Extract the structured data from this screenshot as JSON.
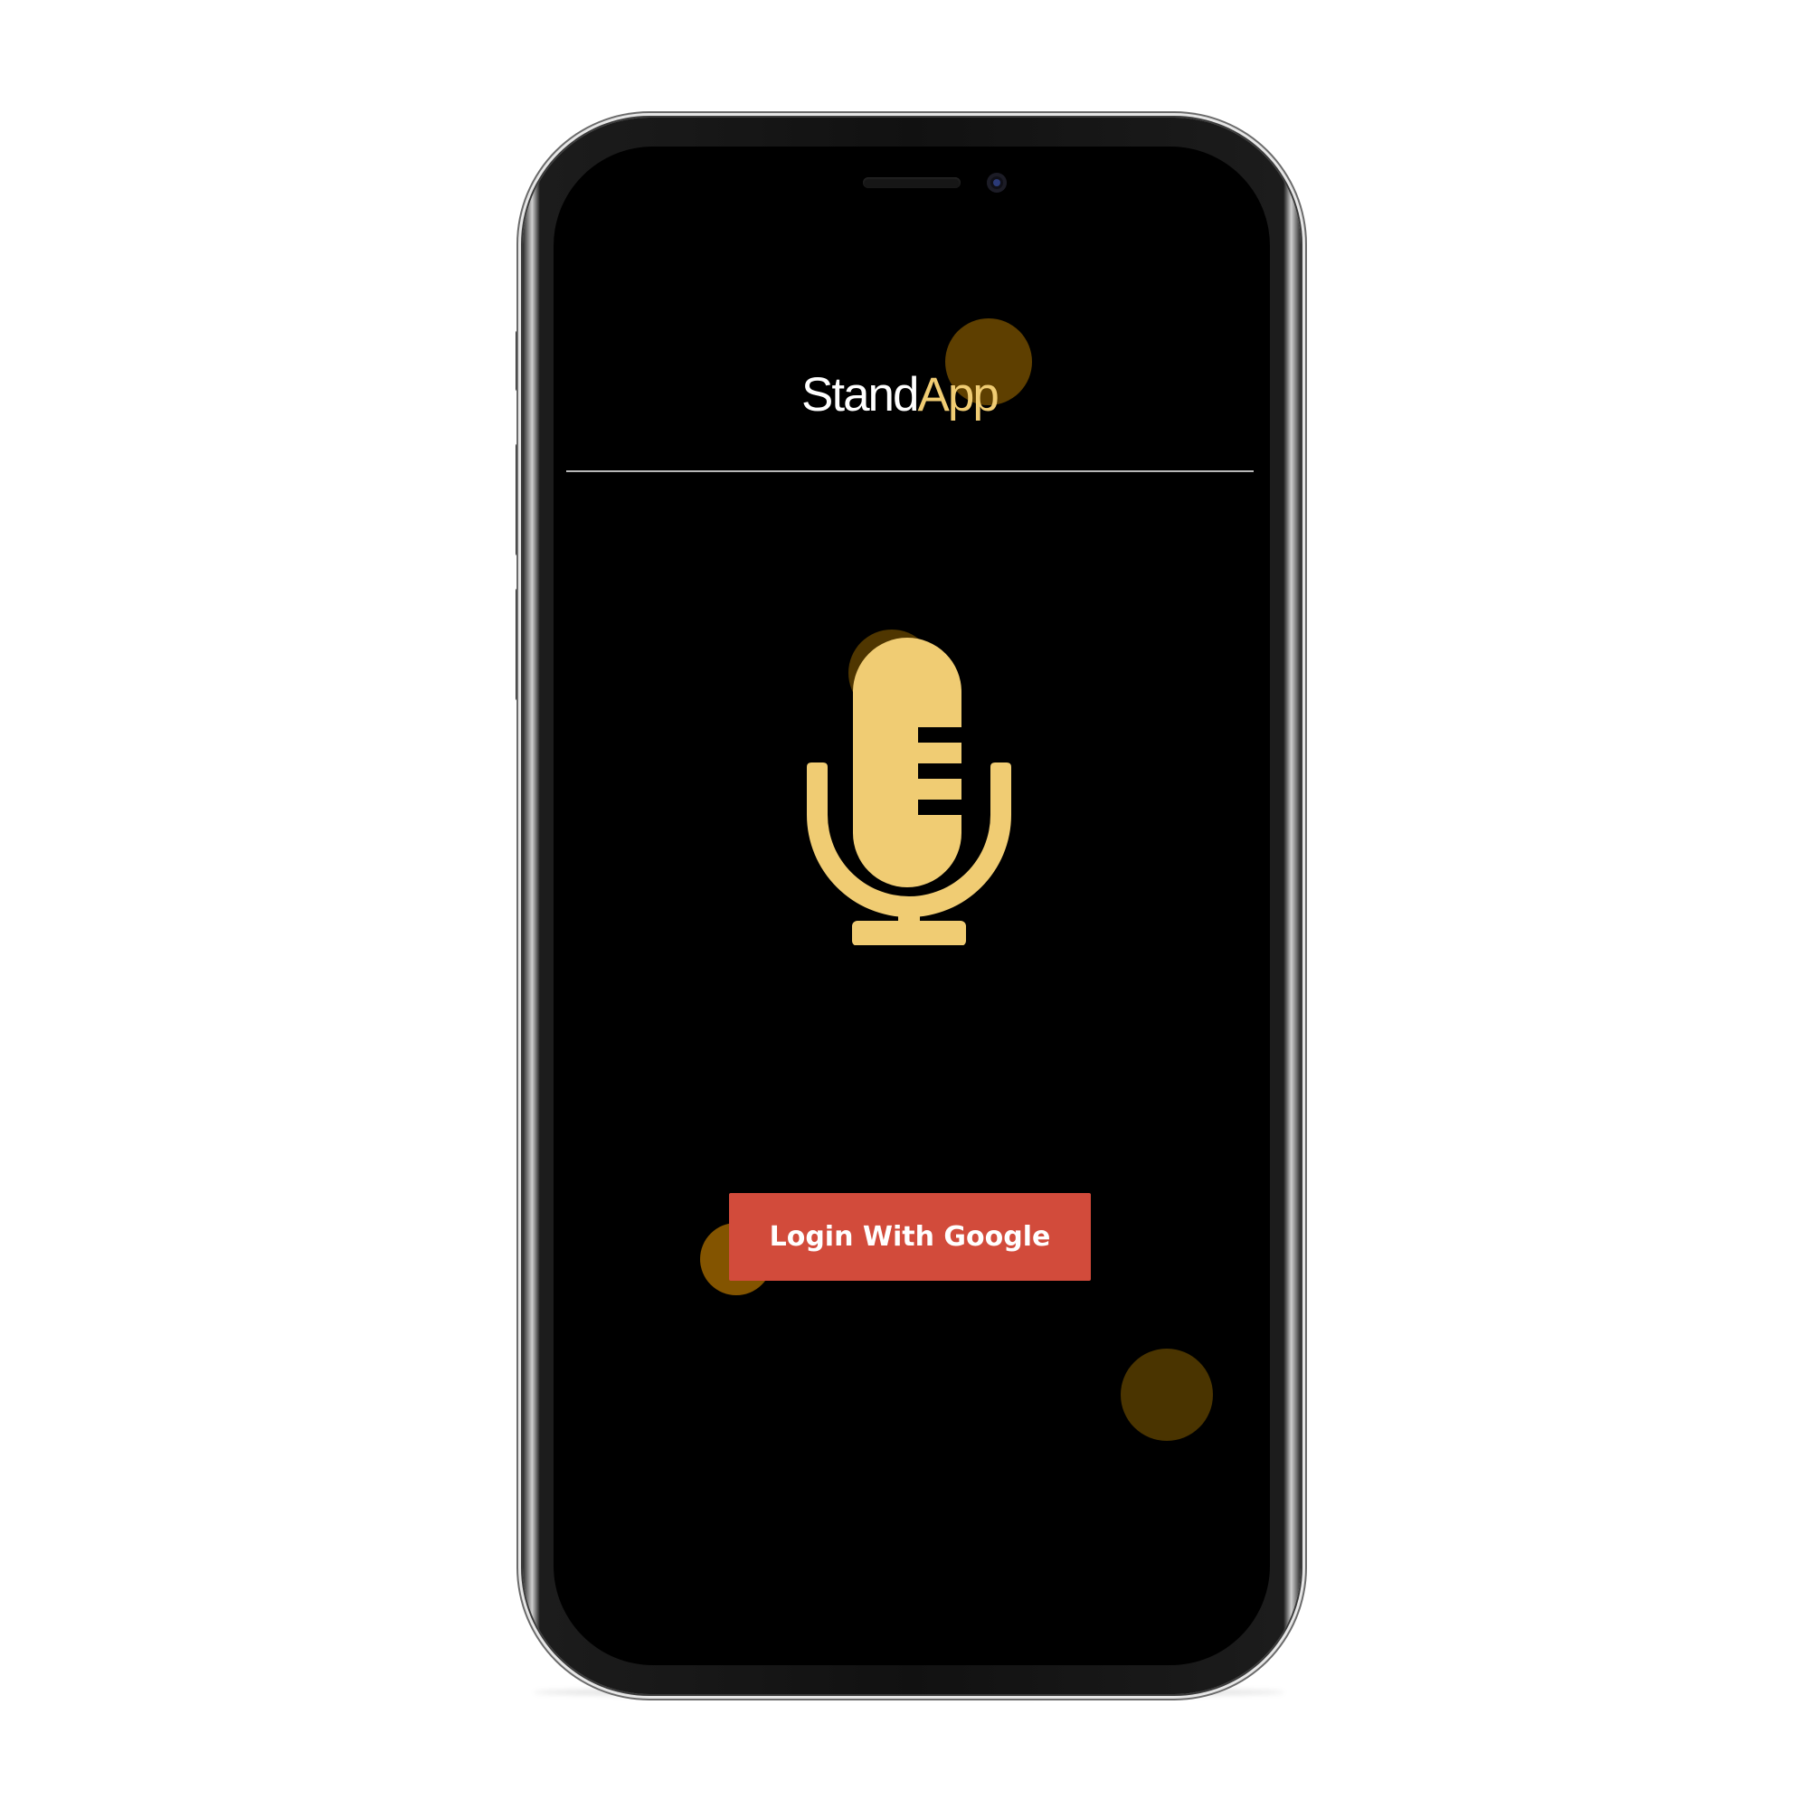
{
  "app": {
    "logo_primary": "Stand",
    "logo_accent": "App"
  },
  "icons": {
    "hero": "microphone-icon"
  },
  "login": {
    "button_label": "Login With Google"
  },
  "colors": {
    "screen_background": "#000000",
    "accent": "#f0cc73",
    "button": "#d24b3b",
    "button_text": "#ffffff",
    "bubbles": "#5e3f00"
  }
}
